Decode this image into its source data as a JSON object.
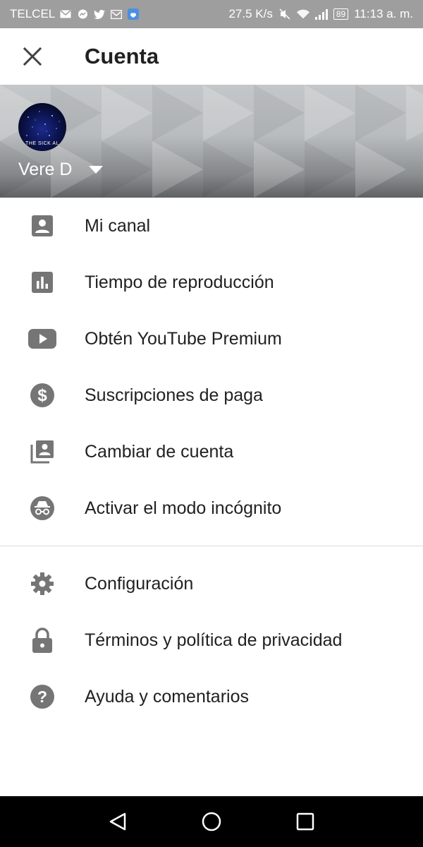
{
  "status_bar": {
    "carrier": "TELCEL",
    "network_speed": "27.5 K/s",
    "battery": "89",
    "time": "11:13 a. m."
  },
  "app_bar": {
    "title": "Cuenta"
  },
  "account": {
    "name": "Vere D",
    "avatar_text": "THE SICK AL"
  },
  "menu_primary": [
    {
      "label": "Mi canal",
      "icon": "account-box-icon"
    },
    {
      "label": "Tiempo de reproducción",
      "icon": "bar-chart-icon"
    },
    {
      "label": "Obtén YouTube Premium",
      "icon": "youtube-play-icon"
    },
    {
      "label": "Suscripciones de paga",
      "icon": "dollar-circle-icon"
    },
    {
      "label": "Cambiar de cuenta",
      "icon": "switch-account-icon"
    },
    {
      "label": "Activar el modo incógnito",
      "icon": "incognito-icon"
    }
  ],
  "menu_secondary": [
    {
      "label": "Configuración",
      "icon": "gear-icon"
    },
    {
      "label": "Términos y política de privacidad",
      "icon": "lock-icon"
    },
    {
      "label": "Ayuda y comentarios",
      "icon": "help-circle-icon"
    }
  ],
  "colors": {
    "icon": "#757575",
    "text": "#212121",
    "status_bar": "#9e9e9e",
    "nav_bar": "#000000"
  }
}
